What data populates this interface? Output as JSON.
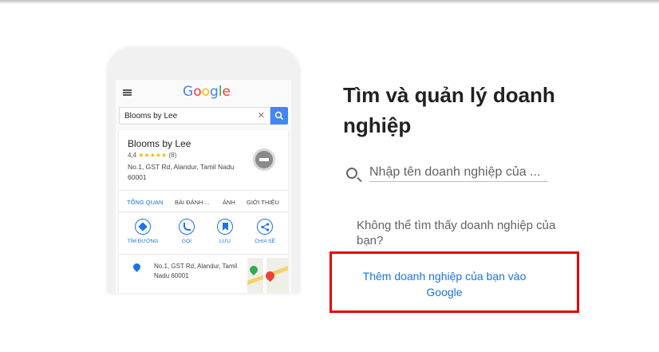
{
  "phone": {
    "logo": [
      "G",
      "o",
      "o",
      "g",
      "l",
      "e"
    ],
    "search_value": "Blooms by Lee",
    "clear_glyph": "✕",
    "card": {
      "name": "Blooms by Lee",
      "rating_value": "4,4",
      "stars": "★★★★★",
      "review_count": "(8)",
      "address": "No.1, GST Rd, Alandur, Tamil Nadu 60001"
    },
    "tabs": [
      "TỔNG QUAN",
      "BÀI ĐÁNH ...",
      "ẢNH",
      "GIỚI THIỆU"
    ],
    "actions": [
      "TÌM ĐƯỜNG",
      "GỌI",
      "LƯU",
      "CHIA SẺ"
    ],
    "address_row": "No.1, GST Rd, Alandur, Tamil Nadu 60001"
  },
  "main": {
    "heading": "Tìm và quản lý doanh nghiệp",
    "search_placeholder": "Nhập tên doanh nghiệp của ...",
    "cant_find": "Không thể tìm thấy doanh nghiệp của bạn?",
    "add_link": "Thêm doanh nghiệp của bạn vào Google"
  },
  "colors": {
    "accent": "#1a73e8",
    "highlight": "#e50000",
    "stars": "#f4b400"
  }
}
